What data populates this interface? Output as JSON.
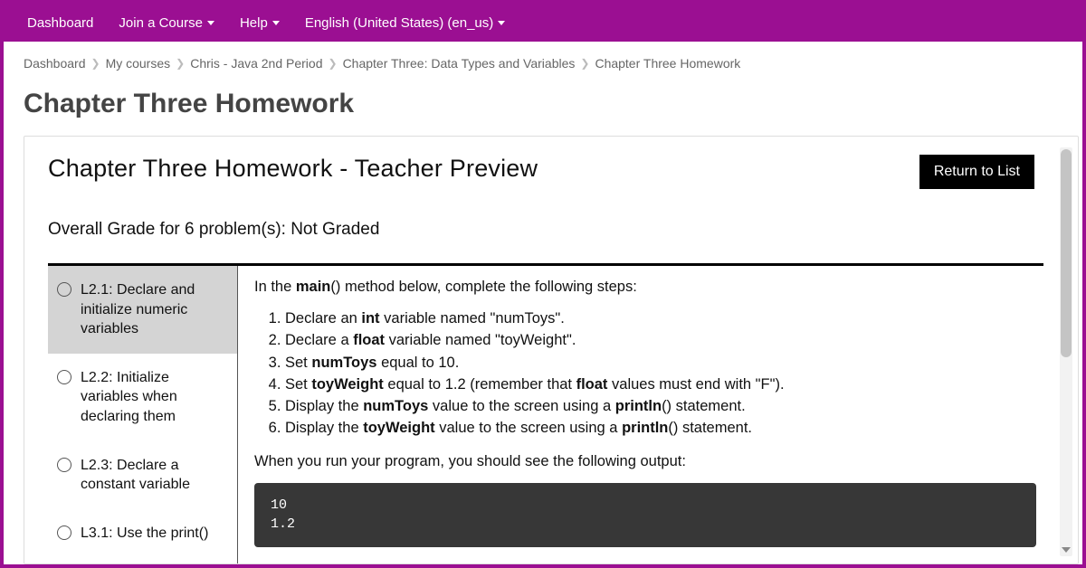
{
  "nav": {
    "dashboard": "Dashboard",
    "join": "Join a Course",
    "help": "Help",
    "lang": "English (United States) (en_us)"
  },
  "breadcrumb": {
    "items": [
      "Dashboard",
      "My courses",
      "Chris - Java 2nd Period",
      "Chapter Three: Data Types and Variables",
      "Chapter Three Homework"
    ]
  },
  "page_title": "Chapter Three Homework",
  "card": {
    "title": "Chapter Three Homework - Teacher Preview",
    "return_btn": "Return to List",
    "grade_prefix": "Overall Grade for 6 problem(s):  ",
    "grade_value": "Not Graded"
  },
  "problems": [
    {
      "label": "L2.1: Declare and initialize numeric variables",
      "active": true
    },
    {
      "label": "L2.2: Initialize variables when declaring them",
      "active": false
    },
    {
      "label": "L2.3: Declare a constant variable",
      "active": false
    },
    {
      "label": "L3.1: Use the print()",
      "active": false
    }
  ],
  "detail": {
    "intro_pre": "In the ",
    "intro_bold": "main",
    "intro_post": "() method below, complete the following steps:",
    "steps": {
      "s1a": "Declare an ",
      "s1b": "int",
      "s1c": " variable named \"numToys\".",
      "s2a": "Declare a ",
      "s2b": "float",
      "s2c": " variable named \"toyWeight\".",
      "s3a": "Set ",
      "s3b": "numToys",
      "s3c": " equal to 10.",
      "s4a": "Set ",
      "s4b": "toyWeight",
      "s4c": " equal to 1.2 (remember that ",
      "s4d": "float",
      "s4e": " values must end with \"F\").",
      "s5a": "Display the ",
      "s5b": "numToys",
      "s5c": " value to the screen using a ",
      "s5d": "println",
      "s5e": "() statement.",
      "s6a": "Display the ",
      "s6b": "toyWeight",
      "s6c": " value to the screen using a ",
      "s6d": "println",
      "s6e": "() statement."
    },
    "outro": "When you run your program, you should see the following output:",
    "output": "10\n1.2"
  }
}
